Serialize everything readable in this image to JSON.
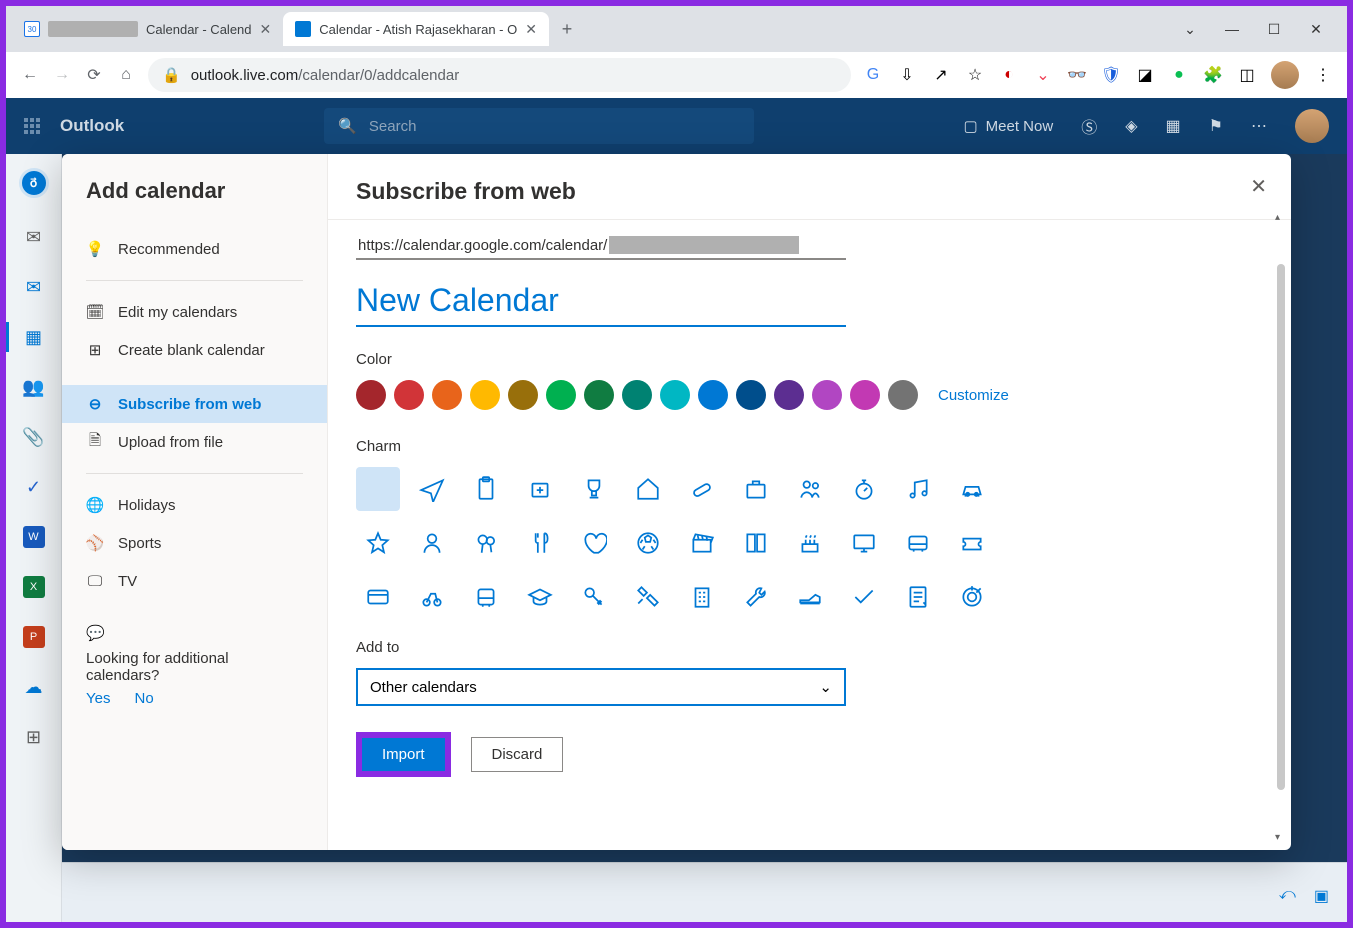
{
  "browser": {
    "tabs": [
      {
        "title": "Calendar - Calend",
        "favicon_color": "#1a73e8",
        "favicon_text": "30"
      },
      {
        "title": "Calendar - Atish Rajasekharan - O",
        "favicon_color": "#0078d4"
      }
    ],
    "url_domain": "outlook.live.com",
    "url_path": "/calendar/0/addcalendar"
  },
  "outlook": {
    "brand": "Outlook",
    "search_placeholder": "Search",
    "meet_now": "Meet Now"
  },
  "modal": {
    "sidebar_title": "Add calendar",
    "items": {
      "recommended": "Recommended",
      "edit": "Edit my calendars",
      "create": "Create blank calendar",
      "subscribe": "Subscribe from web",
      "upload": "Upload from file",
      "holidays": "Holidays",
      "sports": "Sports",
      "tv": "TV"
    },
    "footer_text": "Looking for additional calendars?",
    "footer_yes": "Yes",
    "footer_no": "No",
    "main_title": "Subscribe from web",
    "url_prefix": "https://calendar.google.com/calendar/",
    "name_value": "New Calendar",
    "color_label": "Color",
    "colors": [
      "#a4262c",
      "#d13438",
      "#e8641b",
      "#ffb900",
      "#986f0b",
      "#00b050",
      "#107c41",
      "#008272",
      "#00b7c3",
      "#0078d4",
      "#004e8c",
      "#5c2e91",
      "#b146c2",
      "#c239b3",
      "#737373"
    ],
    "customize": "Customize",
    "charm_label": "Charm",
    "charms": [
      "none",
      "plane",
      "clipboard",
      "medical",
      "trophy",
      "home",
      "pill",
      "briefcase",
      "people",
      "stopwatch",
      "music",
      "car",
      "star",
      "person",
      "balloons",
      "fork",
      "heart",
      "soccer",
      "clapper",
      "book",
      "cake",
      "monitor",
      "bus-alt",
      "ticket",
      "card",
      "bike",
      "bus",
      "grad",
      "key",
      "tools",
      "building",
      "wrench",
      "shoe",
      "checkmark",
      "notes",
      "target"
    ],
    "addto_label": "Add to",
    "addto_value": "Other calendars",
    "import": "Import",
    "discard": "Discard"
  }
}
